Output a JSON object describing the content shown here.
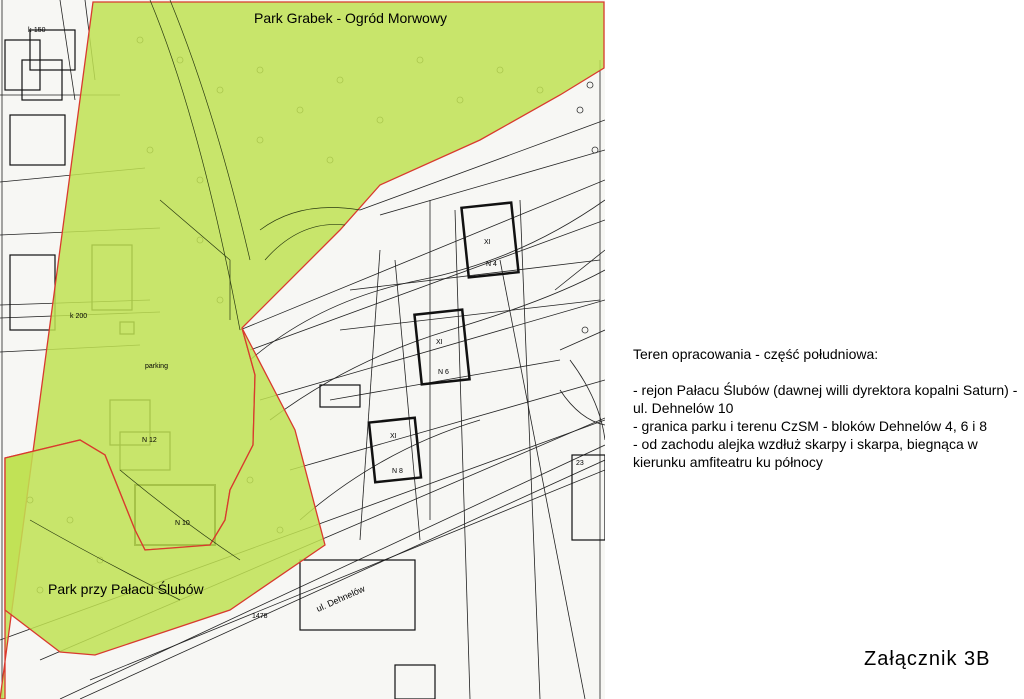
{
  "map": {
    "park_fill_color": "#c0e252",
    "park_border_color": "#d93a2e",
    "line_color": "#111111",
    "labels": {
      "park_north": "Park Grabek - Ogród Morwowy",
      "park_south": "Park przy Pałacu Ślubów"
    },
    "street_label": "ul. Dehnelów",
    "plan_marks": {
      "m1": "XI",
      "m2": "XI",
      "m3": "XI",
      "n4": "N 4",
      "n6": "N 6",
      "n8": "N 8",
      "n10": "N 10",
      "n12": "N 12",
      "n23": "23",
      "parking": "parking",
      "k150": "k-150",
      "k200": "k 200",
      "k1478": "1478"
    }
  },
  "panel": {
    "heading": "Teren opracowania - część południowa:",
    "item1": "- rejon Pałacu Ślubów (dawnej willi dyrektora kopalni Saturn) - ul. Dehnelów 10",
    "item2": "- granica parku i terenu CzSM - bloków Dehnelów 4, 6 i 8",
    "item3": "- od zachodu alejka wzdłuż skarpy i skarpa, biegnąca w kierunku amfiteatru ku północy"
  },
  "attachment_label": "Załącznik 3B"
}
